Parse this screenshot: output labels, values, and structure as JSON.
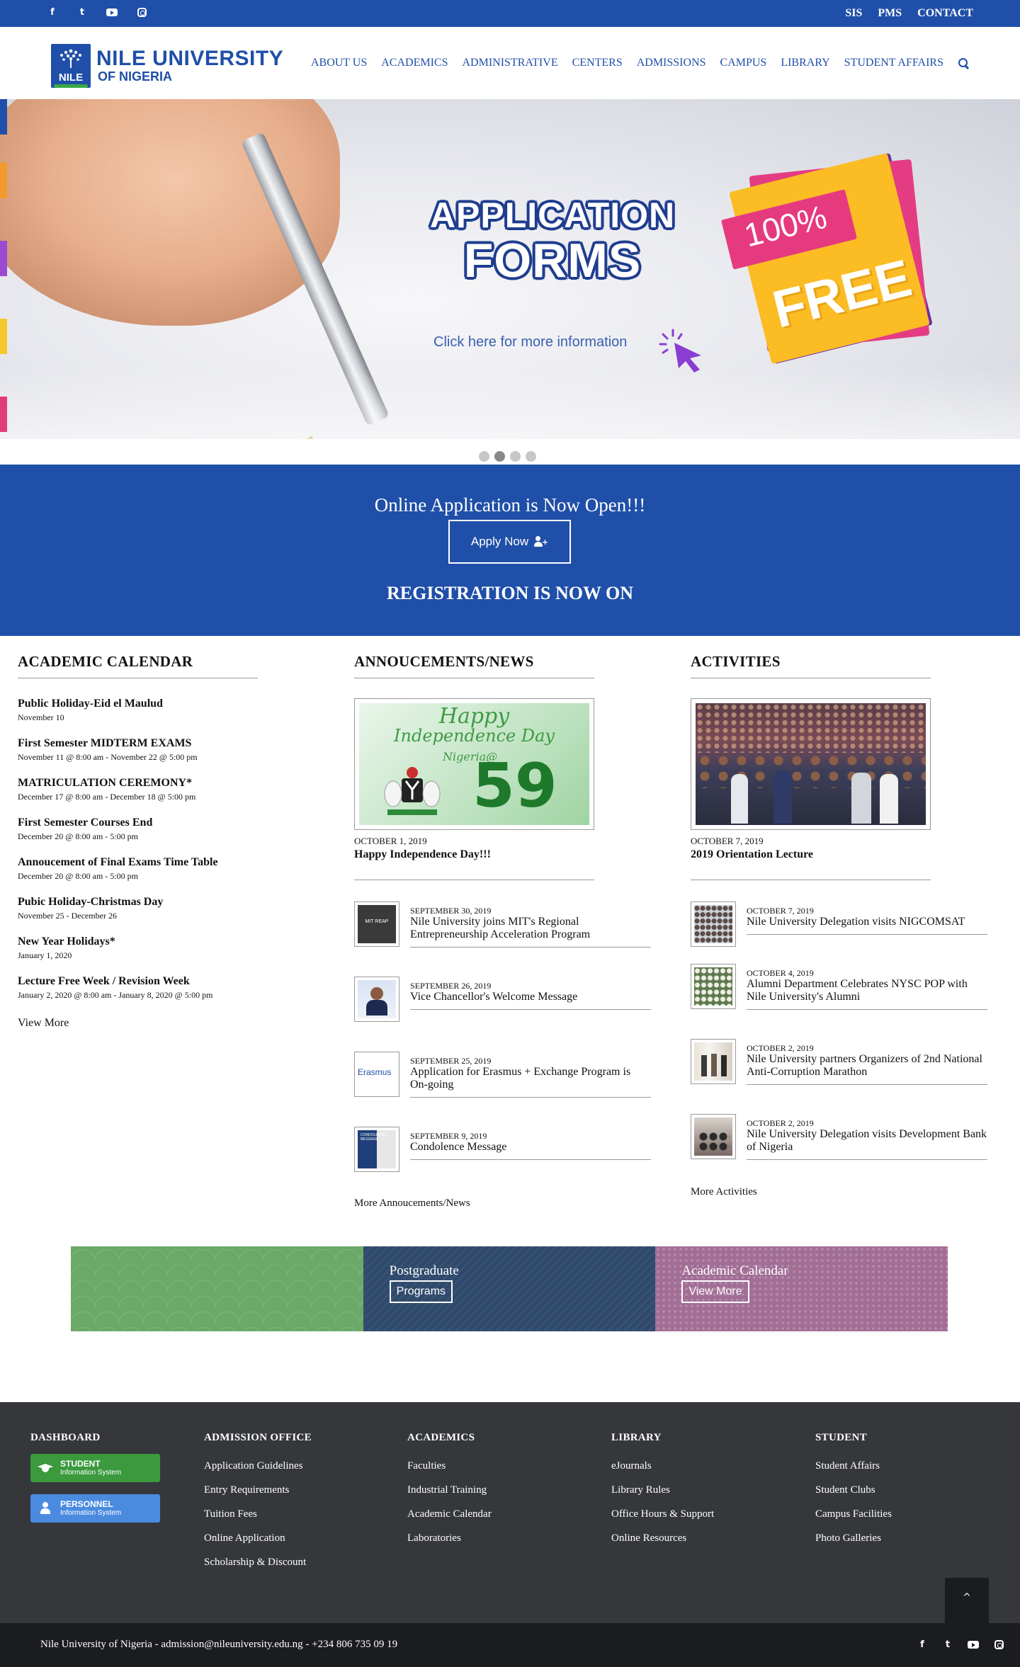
{
  "topbar": {
    "social": [
      "facebook-icon",
      "twitter-icon",
      "youtube-icon",
      "instagram-icon"
    ],
    "links": [
      "SIS",
      "PMS",
      "CONTACT"
    ]
  },
  "header": {
    "logo_line1": "NILE UNIVERSITY",
    "logo_line2": "OF NIGERIA",
    "logo_mark": "NILE",
    "nav": [
      "ABOUT US",
      "ACADEMICS",
      "ADMINISTRATIVE",
      "CENTERS",
      "ADMISSIONS",
      "CAMPUS",
      "LIBRARY",
      "STUDENT AFFAIRS"
    ]
  },
  "hero": {
    "title_line1": "APPLICATION",
    "title_line2": "FORMS",
    "subtitle": "Click here for more information",
    "badge_percent": "100%",
    "badge_free": "FREE",
    "slides": 4,
    "active_slide": 2
  },
  "apply": {
    "headline": "Online Application is Now Open!!!",
    "button": "Apply Now",
    "registration": "REGISTRATION IS NOW ON"
  },
  "calendar": {
    "heading": "ACADEMIC CALENDAR",
    "events": [
      {
        "title": "Public Holiday-Eid el Maulud",
        "date": "November 10"
      },
      {
        "title": "First Semester MIDTERM EXAMS",
        "date": "November 11 @ 8:00 am - November 22 @ 5:00 pm"
      },
      {
        "title": "MATRICULATION CEREMONY*",
        "date": "December 17 @ 8:00 am - December 18 @ 5:00 pm"
      },
      {
        "title": "First Semester Courses End",
        "date": "December 20 @ 8:00 am - 5:00 pm"
      },
      {
        "title": "Annoucement of Final Exams Time Table",
        "date": "December 20 @ 8:00 am - 5:00 pm"
      },
      {
        "title": "Pubic Holiday-Christmas Day",
        "date": "November 25 - December 26"
      },
      {
        "title": "New Year Holidays*",
        "date": "January 1, 2020"
      },
      {
        "title": "Lecture Free Week / Revision Week",
        "date": "January 2, 2020 @ 8:00 am - January 8, 2020 @ 5:00 pm"
      }
    ],
    "more": "View More"
  },
  "news": {
    "heading": "ANNOUCEMENTS/NEWS",
    "featured": {
      "date": "OCTOBER 1, 2019",
      "title": "Happy Independence Day!!!",
      "img_line1": "Happy",
      "img_line2": "Independence Day",
      "img_line3": "Nigeria@",
      "img_num": "59"
    },
    "items": [
      {
        "date": "SEPTEMBER 30, 2019",
        "title": "Nile University joins MIT's Regional Entrepreneurship Acceleration Program",
        "thumb_text": "MIT REAP"
      },
      {
        "date": "SEPTEMBER 26, 2019",
        "title": "Vice Chancellor's Welcome Message",
        "thumb_text": ""
      },
      {
        "date": "SEPTEMBER 25, 2019",
        "title": "Application for Erasmus + Exchange Program is On-going",
        "thumb_text": "Erasmus"
      },
      {
        "date": "SEPTEMBER 9, 2019",
        "title": "Condolence Message",
        "thumb_text": "CONDOLENCE MESSAGE"
      }
    ],
    "more": "More Annoucements/News"
  },
  "activities": {
    "heading": "ACTIVITIES",
    "featured": {
      "date": "OCTOBER 7, 2019",
      "title": "2019 Orientation Lecture"
    },
    "items": [
      {
        "date": "OCTOBER 7, 2019",
        "title": "Nile University Delegation visits NIGCOMSAT"
      },
      {
        "date": "OCTOBER 4, 2019",
        "title": "Alumni Department Celebrates NYSC POP with Nile University's Alumni"
      },
      {
        "date": "OCTOBER 2, 2019",
        "title": "Nile University partners Organizers of 2nd National Anti-Corruption Marathon"
      },
      {
        "date": "OCTOBER 2, 2019",
        "title": "Nile University Delegation visits Development Bank of Nigeria"
      }
    ],
    "more": "More Activities"
  },
  "tiles": [
    {
      "title": "",
      "button": ""
    },
    {
      "title": "Postgraduate",
      "button": "Programs"
    },
    {
      "title": "Academic Calendar",
      "button": "View More"
    }
  ],
  "footer": {
    "dashboard": {
      "heading": "DASHBOARD",
      "student_a": "STUDENT",
      "student_b": "Information System",
      "personnel_a": "PERSONNEL",
      "personnel_b": "Information System"
    },
    "admission": {
      "heading": "ADMISSION OFFICE",
      "links": [
        "Application Guidelines",
        "Entry Requirements",
        "Tuition Fees",
        "Online Application",
        "Scholarship & Discount"
      ]
    },
    "academics": {
      "heading": "ACADEMICS",
      "links": [
        "Faculties",
        "Industrial Training",
        "Academic Calendar",
        "Laboratories"
      ]
    },
    "library": {
      "heading": "LIBRARY",
      "links": [
        "eJournals",
        "Library Rules",
        "Office Hours & Support",
        "Online Resources"
      ]
    },
    "student": {
      "heading": "STUDENT",
      "links": [
        "Student Affairs",
        "Student Clubs",
        "Campus Facilities",
        "Photo Galleries"
      ]
    },
    "to_top": "^",
    "copyright": "Nile University of Nigeria - admission@nileuniversity.edu.ng - +234 806 735 09 19"
  },
  "colors": {
    "brand_blue": "#1f4fa8",
    "footer_bg": "#35373b",
    "bottom_bg": "#1b1c1f",
    "student_green": "#3a9a3d",
    "personnel_blue": "#4a8be0"
  }
}
